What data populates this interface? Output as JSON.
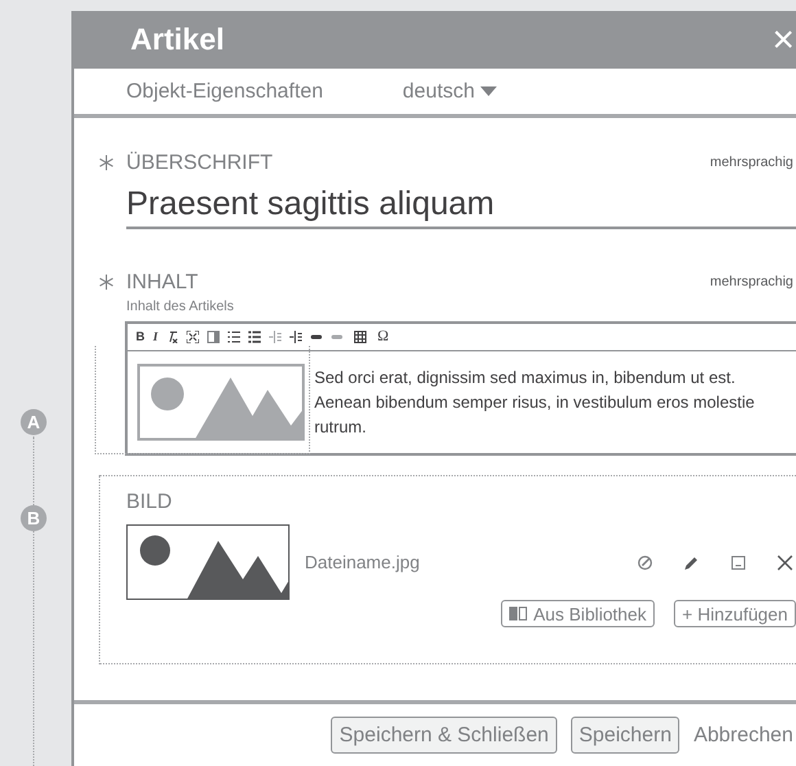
{
  "window": {
    "title": "Artikel",
    "close": "×"
  },
  "tab_bar": {
    "tab": "Objekt-Eigenschaften",
    "language": "deutsch"
  },
  "markers": [
    {
      "label": "A"
    },
    {
      "label": "B"
    }
  ],
  "heading_field": {
    "label": "ÜBERSCHRIFT",
    "required": true,
    "badge": "mehrsprachig",
    "value": "Praesent sagittis aliquam"
  },
  "content_field": {
    "label": "INHALT",
    "required": true,
    "badge": "mehrsprachig",
    "hint": "Inhalt des Artikels",
    "toolbar": {
      "bold": "B",
      "italic": "I",
      "special_char": "Ω"
    },
    "text": "Sed orci erat, dignissim sed maximus in, bibendum ut est. Aenean bibendum semper risus, in vestibulum eros molestie rutrum."
  },
  "image_field": {
    "label": "BILD",
    "filename": "Dateiname.jpg",
    "buttons": [
      "Aus Bibliothek",
      "+ Hinzufügen"
    ]
  },
  "footer": {
    "buttons": [
      "Speichern & Schließen",
      "Speichern"
    ],
    "cancel": "Abbrechen"
  }
}
